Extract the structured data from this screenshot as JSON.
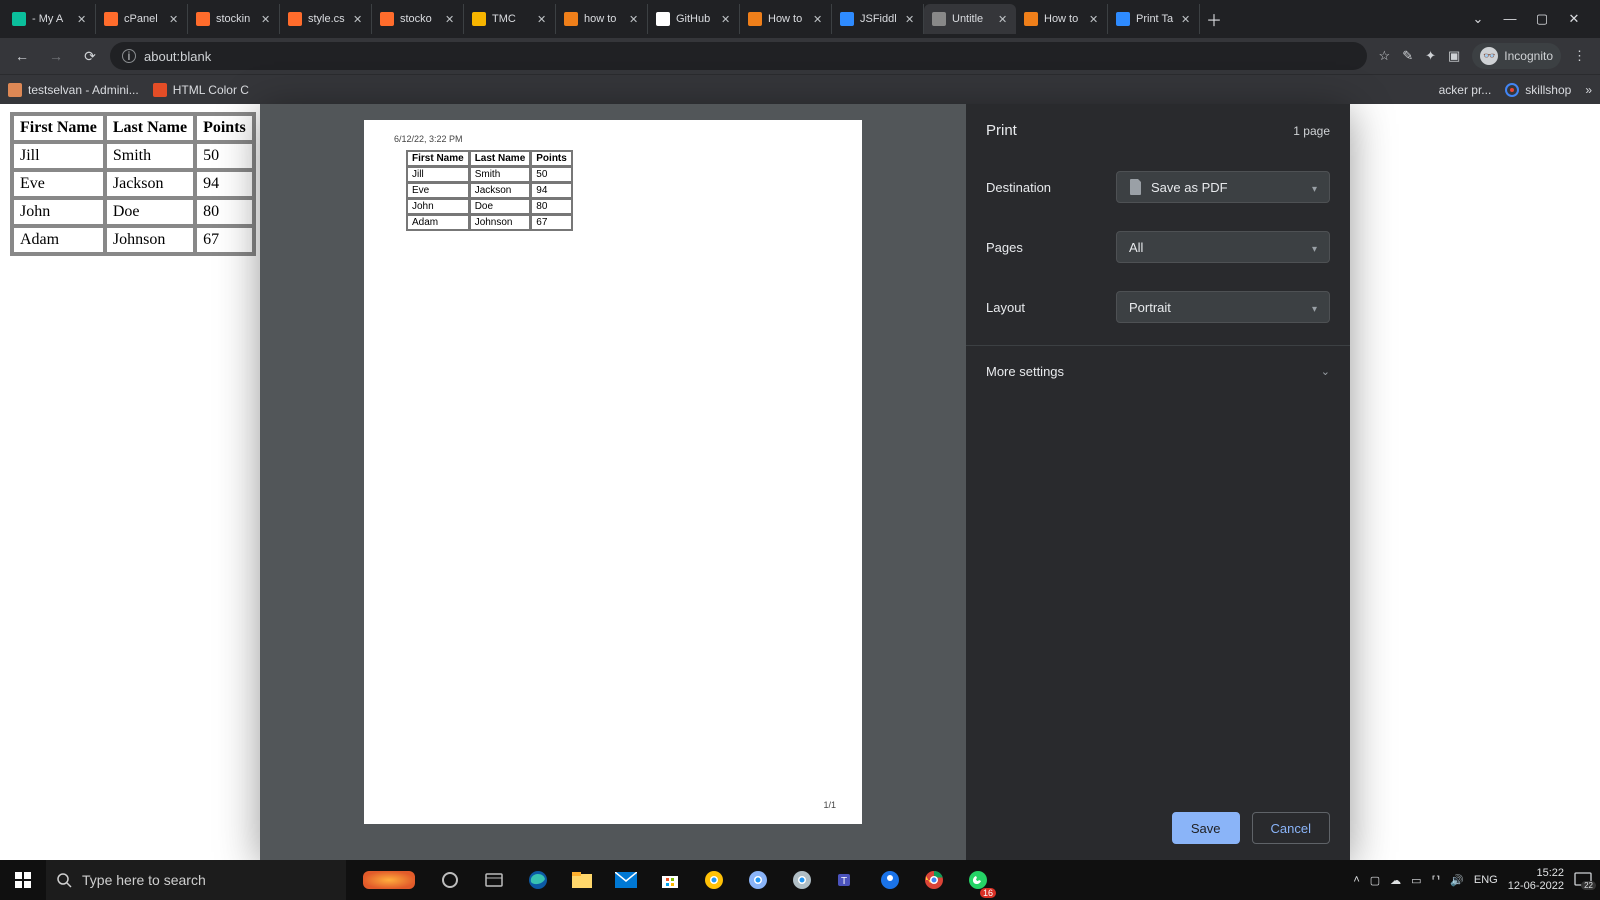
{
  "tabs": [
    {
      "label": "- My A"
    },
    {
      "label": "cPanel"
    },
    {
      "label": "stockin"
    },
    {
      "label": "style.cs"
    },
    {
      "label": "stocko"
    },
    {
      "label": "TMC"
    },
    {
      "label": "how to"
    },
    {
      "label": "GitHub"
    },
    {
      "label": "How to"
    },
    {
      "label": "JSFiddl"
    },
    {
      "label": "Untitle"
    },
    {
      "label": "How to"
    },
    {
      "label": "Print Ta"
    }
  ],
  "active_tab_index": 10,
  "url": "about:blank",
  "incognito_label": "Incognito",
  "bookmarks": [
    {
      "label": "testselvan - Admini..."
    },
    {
      "label": "HTML Color C"
    }
  ],
  "bookmarks_right": [
    {
      "label": "acker pr..."
    },
    {
      "label": "skillshop"
    }
  ],
  "table": {
    "headers": [
      "First Name",
      "Last Name",
      "Points"
    ],
    "rows": [
      [
        "Jill",
        "Smith",
        "50"
      ],
      [
        "Eve",
        "Jackson",
        "94"
      ],
      [
        "John",
        "Doe",
        "80"
      ],
      [
        "Adam",
        "Johnson",
        "67"
      ]
    ]
  },
  "preview": {
    "timestamp": "6/12/22, 3:22 PM",
    "pagenum": "1/1"
  },
  "print": {
    "title": "Print",
    "page_count": "1 page",
    "destination_label": "Destination",
    "destination_value": "Save as PDF",
    "pages_label": "Pages",
    "pages_value": "All",
    "layout_label": "Layout",
    "layout_value": "Portrait",
    "more_label": "More settings",
    "save_label": "Save",
    "cancel_label": "Cancel"
  },
  "taskbar": {
    "search_placeholder": "Type here to search",
    "lang": "ENG",
    "time": "15:22",
    "date": "12-06-2022",
    "notif_count": "22",
    "badge_16": "16"
  }
}
